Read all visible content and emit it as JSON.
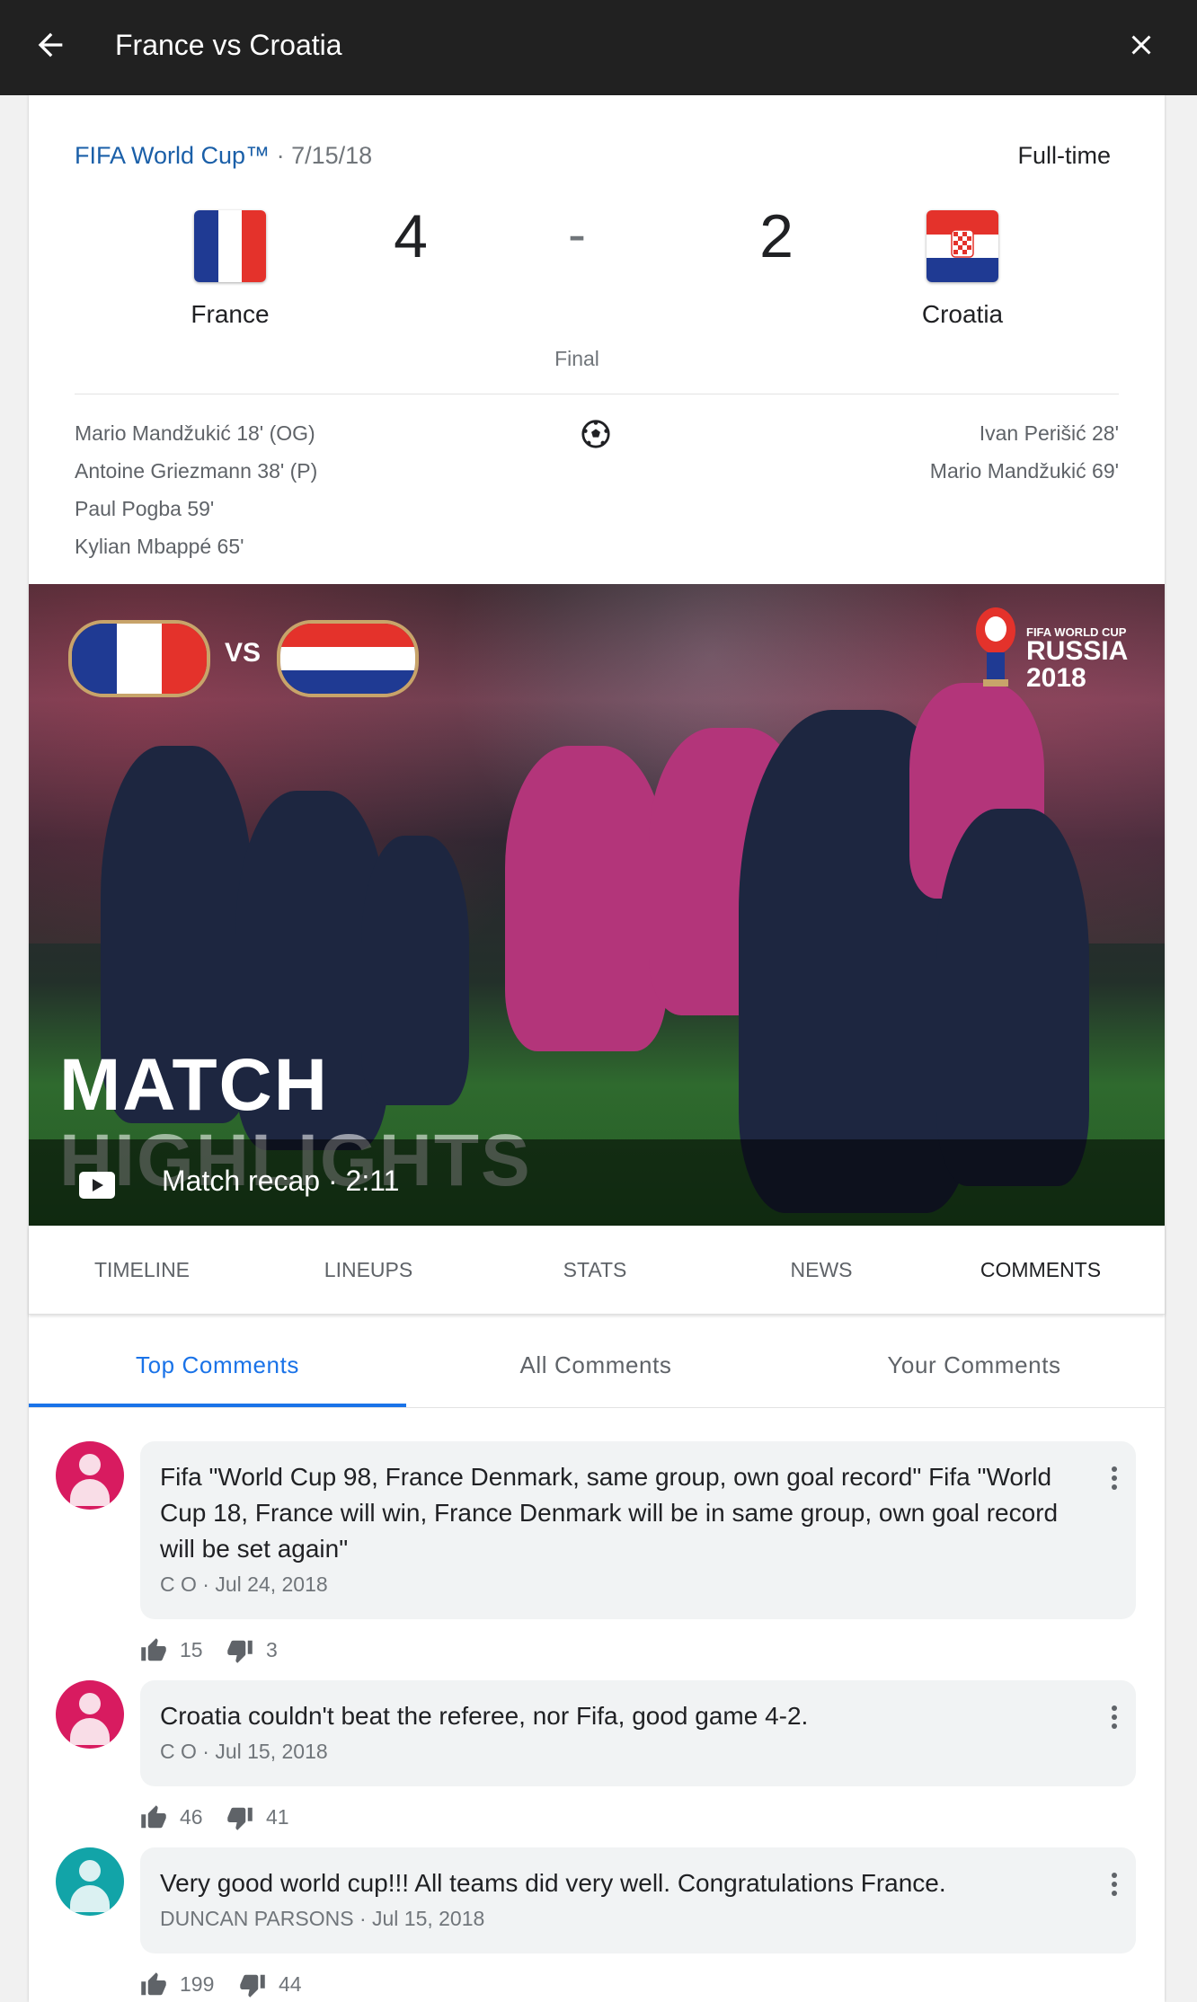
{
  "header": {
    "title": "France vs Croatia",
    "back_icon": "arrow-back-icon",
    "close_icon": "close-icon"
  },
  "match": {
    "competition": "FIFA World Cup™",
    "date": "· 7/15/18",
    "status": "Full-time",
    "home": {
      "name": "France",
      "score": "4",
      "flag_colors": [
        "#1f3a93",
        "#ffffff",
        "#e4322b"
      ]
    },
    "away": {
      "name": "Croatia",
      "score": "2",
      "flag_colors": [
        "#e4322b",
        "#ffffff",
        "#1f3a93"
      ]
    },
    "separator": "-",
    "stage": "Final",
    "home_scorers": [
      "Mario Mandžukić 18' (OG)",
      "Antoine Griezmann 38' (P)",
      "Paul Pogba 59'",
      "Kylian Mbappé 65'"
    ],
    "away_scorers": [
      "Ivan Perišić 28'",
      "Mario Mandžukić 69'"
    ]
  },
  "video": {
    "overlay_title_1": "MATCH",
    "overlay_title_2": "HIGHLIGHTS",
    "vs": "VS",
    "logo_small": "FIFA WORLD CUP",
    "logo_big_1": "RUSSIA",
    "logo_big_2": "2018",
    "label": "Match recap · 2:11"
  },
  "tabs": [
    "TIMELINE",
    "LINEUPS",
    "STATS",
    "NEWS",
    "COMMENTS"
  ],
  "active_tab": "COMMENTS",
  "comment_tabs": [
    "Top Comments",
    "All Comments",
    "Your Comments"
  ],
  "active_comment_tab": "Top Comments",
  "comments": [
    {
      "text": "Fifa \"World Cup 98, France Denmark, same group, own goal record\" Fifa \"World Cup 18, France will win, France Denmark will be in same group, own goal record will be set again\"",
      "author": "C O",
      "date": "· Jul 24, 2018",
      "likes": "15",
      "dislikes": "3",
      "avatar_color": "#d81b60"
    },
    {
      "text": "Croatia couldn't beat the referee, nor Fifa, good game 4-2.",
      "author": "C O",
      "date": "· Jul 15, 2018",
      "likes": "46",
      "dislikes": "41",
      "avatar_color": "#d81b60"
    },
    {
      "text": "Very good world cup!!! All teams did very well. Congratulations France.",
      "author": "DUNCAN PARSONS",
      "date": "· Jul 15, 2018",
      "likes": "199",
      "dislikes": "44",
      "avatar_color": "#12a4a8"
    }
  ]
}
